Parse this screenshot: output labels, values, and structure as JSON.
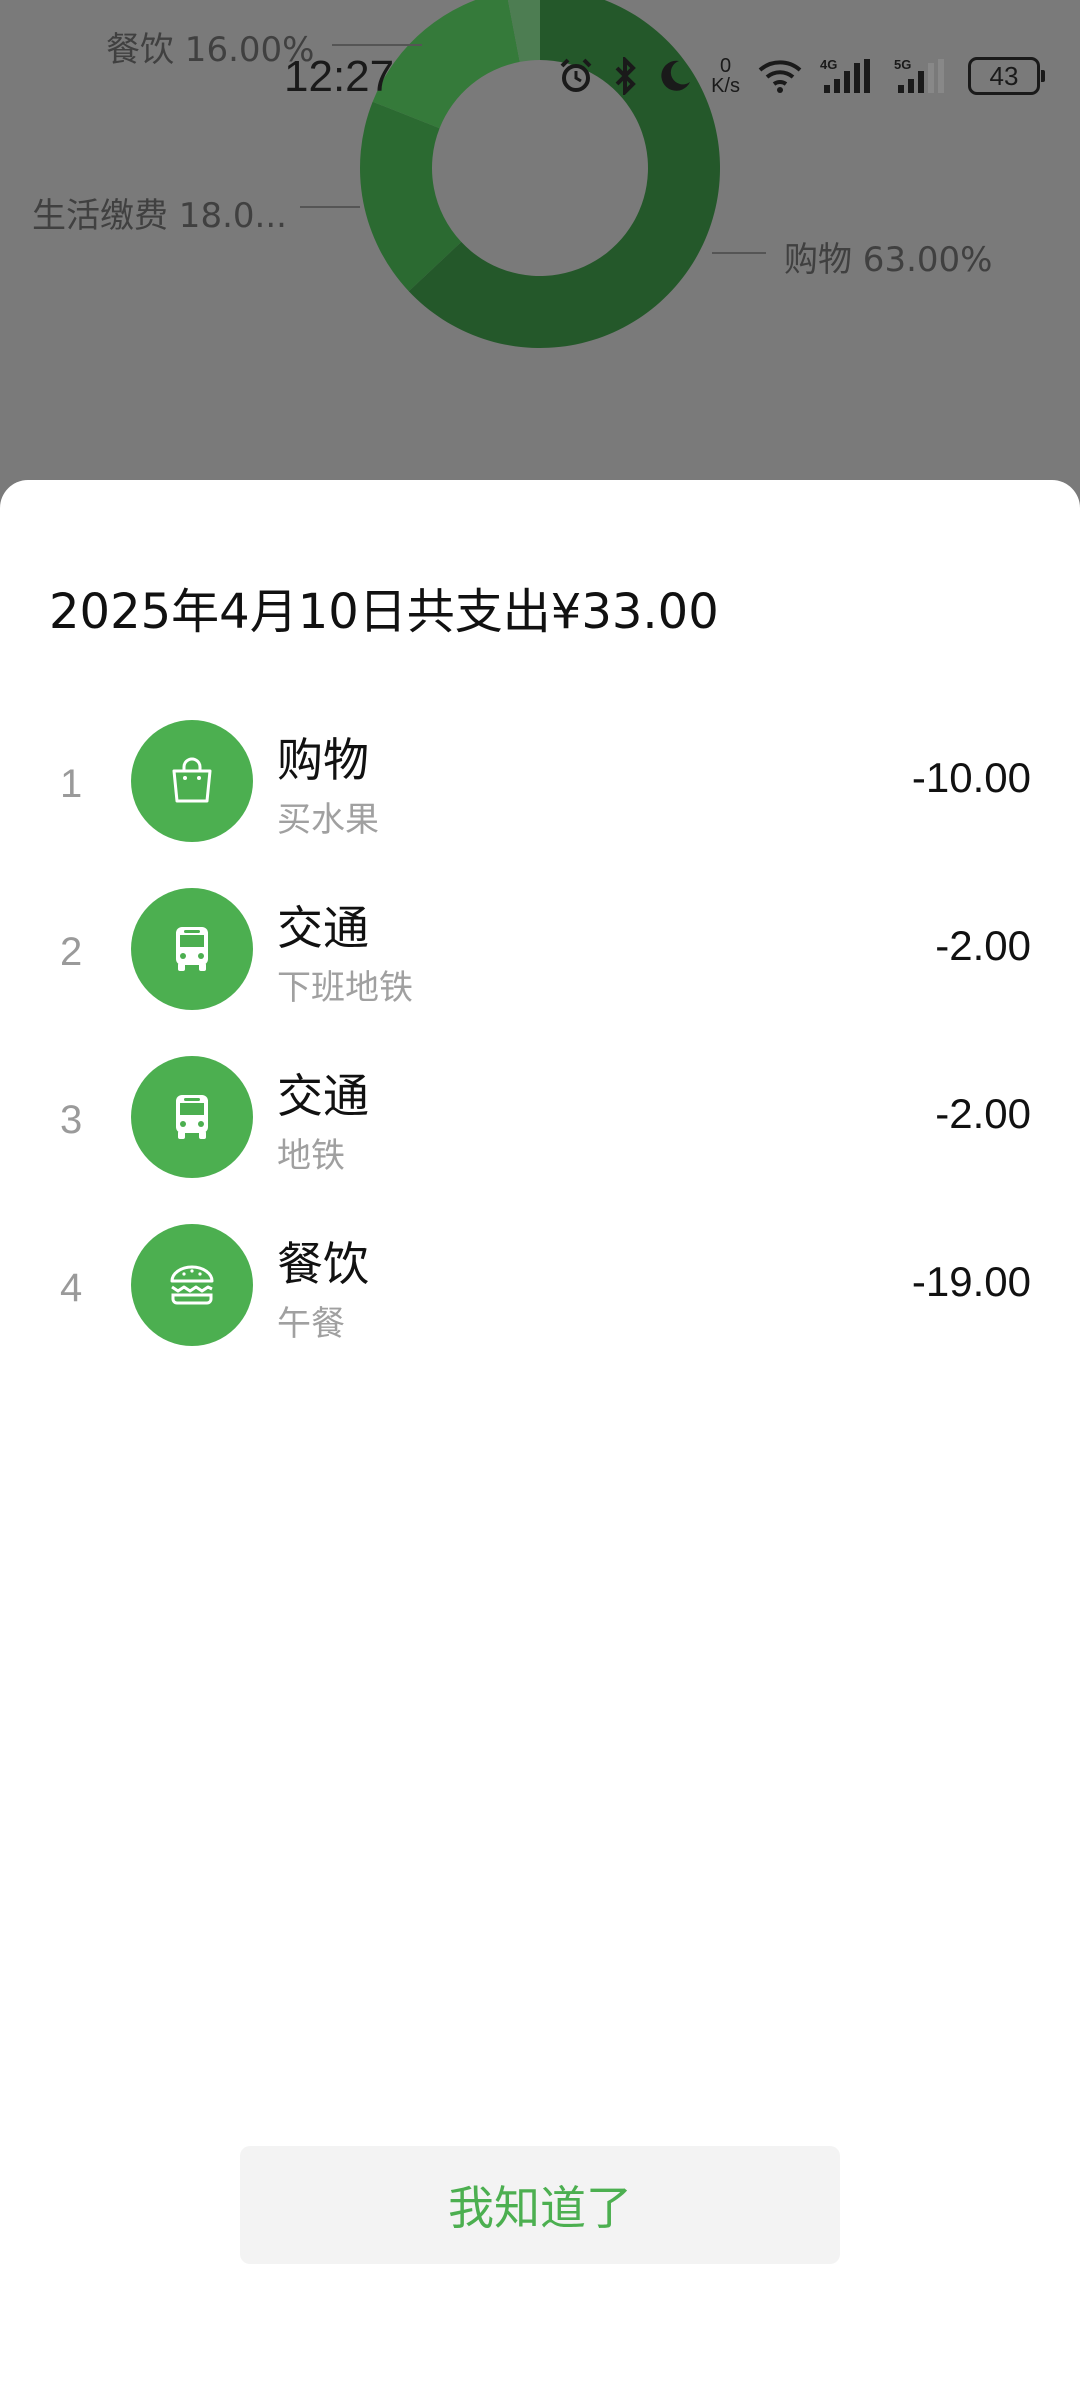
{
  "status_bar": {
    "time": "12:27",
    "net_speed_value": "0",
    "net_speed_unit": "K/s",
    "signal_1_label": "4G",
    "signal_2_label": "5G",
    "battery": "43"
  },
  "chart_data": {
    "type": "pie",
    "slices": [
      {
        "label": "购物 63.00%",
        "value": 63.0,
        "color": "#24582a"
      },
      {
        "label": "生活缴费 18.0...",
        "value": 18.0,
        "color": "#2b6a31"
      },
      {
        "label": "餐饮 16.00%",
        "value": 16.0,
        "color": "#357a3a"
      },
      {
        "label": "",
        "value": 3.0,
        "color": "#4d7d52"
      }
    ]
  },
  "sheet": {
    "title": "2025年4月10日共支出¥33.00",
    "items": [
      {
        "index": "1",
        "category": "购物",
        "note": "买水果",
        "amount": "-10.00",
        "icon": "shopping-bag-icon"
      },
      {
        "index": "2",
        "category": "交通",
        "note": "下班地铁",
        "amount": "-2.00",
        "icon": "bus-icon"
      },
      {
        "index": "3",
        "category": "交通",
        "note": "地铁",
        "amount": "-2.00",
        "icon": "bus-icon"
      },
      {
        "index": "4",
        "category": "餐饮",
        "note": "午餐",
        "amount": "-19.00",
        "icon": "burger-icon"
      }
    ],
    "confirm_label": "我知道了"
  },
  "colors": {
    "accent": "#4caf50",
    "overlay": "#7a7a7a"
  }
}
